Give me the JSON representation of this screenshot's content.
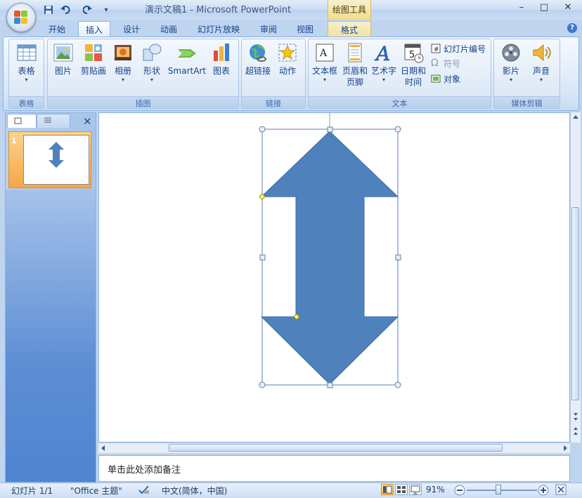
{
  "window": {
    "title": "演示文稿1 - Microsoft PowerPoint",
    "context_tab_group": "绘图工具",
    "controls": {
      "minimize": "–",
      "maximize": "□",
      "close": "✕"
    }
  },
  "qat": {
    "customize": "▾"
  },
  "tabs": [
    {
      "label": "开始"
    },
    {
      "label": "插入"
    },
    {
      "label": "设计"
    },
    {
      "label": "动画"
    },
    {
      "label": "幻灯片放映"
    },
    {
      "label": "审阅"
    },
    {
      "label": "视图"
    },
    {
      "label": "格式"
    }
  ],
  "ribbon": {
    "groups": {
      "tables": {
        "label": "表格",
        "table": "表格"
      },
      "illustrations": {
        "label": "插图",
        "picture": "图片",
        "clipart": "剪贴画",
        "album": "相册",
        "shapes": "形状",
        "smartart": "SmartArt",
        "chart": "图表"
      },
      "links": {
        "label": "链接",
        "hyperlink": "超链接",
        "action": "动作"
      },
      "text": {
        "label": "文本",
        "textbox": "文本框",
        "header_footer_1": "页眉和",
        "header_footer_2": "页脚",
        "wordart": "艺术字",
        "datetime_1": "日期和",
        "datetime_2": "时间",
        "slide_number": "幻灯片编号",
        "symbol": "符号",
        "object": "对象"
      },
      "media": {
        "label": "媒体剪辑",
        "movie": "影片",
        "sound": "声音"
      }
    },
    "dropdown_glyph": "▾"
  },
  "slides_pane": {
    "slide_number": "1",
    "close": "✕"
  },
  "notes": {
    "placeholder": "单击此处添加备注"
  },
  "status": {
    "slide": "幻灯片 1/1",
    "theme": "\"Office 主题\"",
    "language": "中文(简体，中国)",
    "zoom": "91%"
  },
  "colors": {
    "shape_fill": "#4f81bd",
    "shape_stroke": "#3a6aa8"
  }
}
